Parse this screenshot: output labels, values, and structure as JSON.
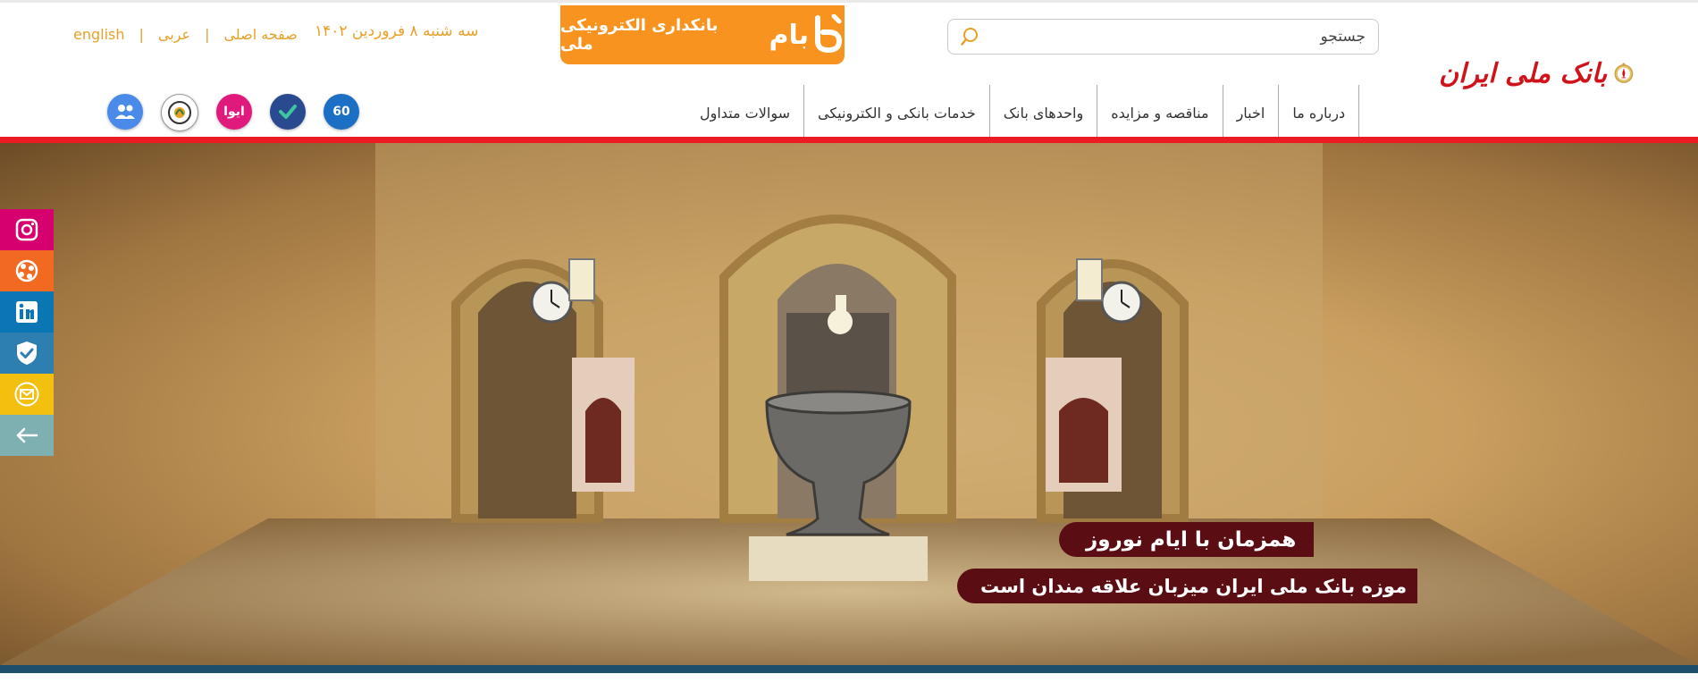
{
  "header": {
    "top_links": {
      "english": "english",
      "arabic": "عربی",
      "home": "صفحه اصلی"
    },
    "date": "سه شنبه ۸ فروردین ۱۴۰۲",
    "bam_banner": {
      "title": "بانکداری الکترونیکی ملی",
      "logo_word": "بام",
      "icon": "bam-logo-icon",
      "color": "#f7931e"
    },
    "search": {
      "placeholder": "جستجو",
      "icon": "search-icon"
    },
    "logo": {
      "text": "بانک ملی ایران",
      "icon": "bank-emblem-icon",
      "color": "#d0121b"
    }
  },
  "nav": {
    "items": [
      {
        "label": "درباره ما"
      },
      {
        "label": "اخبار"
      },
      {
        "label": "مناقصه و مزایده"
      },
      {
        "label": "واحدهای بانک"
      },
      {
        "label": "خدمات بانکی و الکترونیکی"
      },
      {
        "label": "سوالات متداول"
      }
    ]
  },
  "quick_icons": [
    {
      "icon": "group-icon",
      "color": "#4a8ae8"
    },
    {
      "icon": "seal-icon",
      "color": "#ffffff"
    },
    {
      "icon": "aiwa-icon",
      "label": "ایوا",
      "color": "#e0197d"
    },
    {
      "icon": "checkmark-icon",
      "color": "#2a4a8f"
    },
    {
      "icon": "sixty-icon",
      "label": "60",
      "color": "#1b6fc4"
    }
  ],
  "slider": {
    "caption_1": "همزمان با ایام نوروز",
    "caption_2": "موزه بانک ملی ایران میزبان علاقه مندان است",
    "caption_color": "#5a0d12"
  },
  "social": [
    {
      "icon": "instagram-icon",
      "color": "#d6006f"
    },
    {
      "icon": "aparat-icon",
      "color": "#f26a21"
    },
    {
      "icon": "linkedin-icon",
      "color": "#0a76b4"
    },
    {
      "icon": "shield-check-icon",
      "color": "#2c7fb0"
    },
    {
      "icon": "email-icon",
      "color": "#f4c010"
    },
    {
      "icon": "arrow-left-icon",
      "color": "#7fb0b1"
    }
  ],
  "accent_red": "#ed1c24"
}
